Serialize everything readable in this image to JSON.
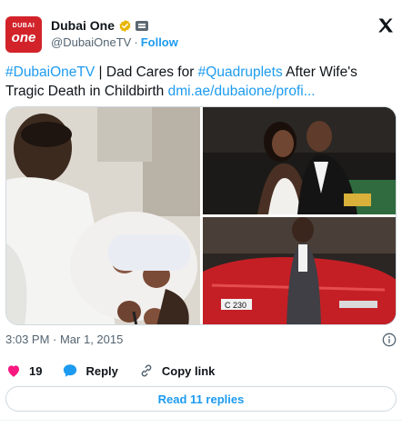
{
  "account": {
    "name": "Dubai One",
    "handle": "@DubaiOneTV",
    "separator": "·",
    "follow_label": "Follow",
    "avatar_line1": "DUBAI",
    "avatar_line2": "one"
  },
  "tweet": {
    "hashtag1": "#DubaiOneTV",
    "text1": " | Dad Cares for ",
    "hashtag2": "#Quadruplets",
    "text2": " After Wife's Tragic Death in Childbirth ",
    "link": "dmi.ae/dubaione/profi..."
  },
  "photos": {
    "license_plate": "C 230"
  },
  "meta": {
    "time": "3:03 PM · Mar 1, 2015"
  },
  "actions": {
    "like_count": "19",
    "reply_label": "Reply",
    "copy_label": "Copy link"
  },
  "replies_button": "Read 11 replies",
  "colors": {
    "brand": "#d2232a",
    "link": "#1d9bf0",
    "like": "#f91880",
    "muted": "#536471"
  },
  "icons": [
    "verified-badge-icon",
    "affiliate-badge-icon",
    "x-logo-icon",
    "info-icon",
    "heart-icon",
    "reply-bubble-icon",
    "link-icon"
  ]
}
